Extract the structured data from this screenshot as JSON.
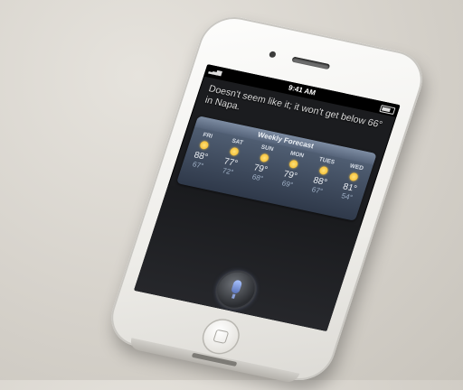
{
  "screen": {
    "status_time": "9:41 AM",
    "siri_response": "Doesn't seem like it; it won't get below 66° in Napa.",
    "weather": {
      "title": "Weekly Forecast",
      "days": [
        {
          "day": "FRI",
          "high": "88°",
          "low": "67°"
        },
        {
          "day": "SAT",
          "high": "77°",
          "low": "72°"
        },
        {
          "day": "SUN",
          "high": "79°",
          "low": "68°"
        },
        {
          "day": "MON",
          "high": "79°",
          "low": "69°"
        },
        {
          "day": "TUES",
          "high": "88°",
          "low": "67°"
        },
        {
          "day": "WED",
          "high": "81°",
          "low": "54°"
        }
      ]
    },
    "icons": {
      "weather_condition": "sun-icon",
      "siri_button": "microphone-icon"
    }
  },
  "colors": {
    "device_body": "#f2f1ee",
    "screen_background": "#1b1c1f",
    "weather_card": "#3d4a5e",
    "sun": "#f0b320"
  }
}
